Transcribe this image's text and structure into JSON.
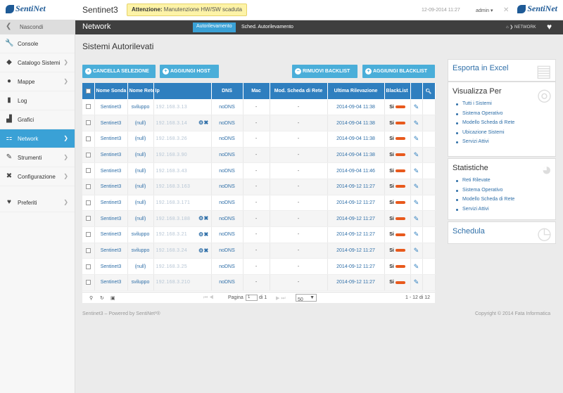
{
  "header": {
    "logo": "SentiNet",
    "app_title": "Sentinet3",
    "warning_label": "Attenzione:",
    "warning_text": "Manutenzione HW/SW scaduta",
    "datetime": "12-09-2014 11:27",
    "user": "admin"
  },
  "sidebar": {
    "hide_label": "Nascondi",
    "items": [
      {
        "label": "Console",
        "icon": "wrench-icon",
        "chevron": false
      },
      {
        "label": "Catalogo Sistemi",
        "icon": "tag-icon",
        "chevron": true
      },
      {
        "label": "Mappe",
        "icon": "globe-icon",
        "chevron": true
      },
      {
        "label": "Log",
        "icon": "book-icon",
        "chevron": false
      },
      {
        "label": "Grafici",
        "icon": "chart-icon",
        "chevron": false
      },
      {
        "label": "Network",
        "icon": "network-icon",
        "chevron": true,
        "active": true
      },
      {
        "label": "Strumenti",
        "icon": "tools-icon",
        "chevron": true
      },
      {
        "label": "Configurazione",
        "icon": "config-icon",
        "chevron": true
      },
      {
        "label": "Preferiti",
        "icon": "heart-icon",
        "chevron": true
      }
    ]
  },
  "navbar": {
    "section": "Network",
    "tab_active": "Autorilevamento",
    "tab_other": "Sched. Autorilevamento",
    "breadcrumb": "NETWORK"
  },
  "page": {
    "title": "Sistemi Autorilevati"
  },
  "buttons": {
    "cancel": "CANCELLA SELEZIONE",
    "add_host": "AGGIUNGI HOST",
    "remove_bl": "RIMUOVI BACKLIST",
    "add_bl": "AGGIUNGI BLACKLIST"
  },
  "table": {
    "headers": [
      "Nome Sonda",
      "Nome Rete",
      "Ip",
      "DNS",
      "Mac",
      "Mod. Scheda di Rete",
      "Ultima Rilevazione",
      "BlackList"
    ],
    "rows": [
      {
        "sonda": "Sentinet3",
        "rete": "sviluppo",
        "ip": "192.168.3.13",
        "tools": false,
        "dns": "noDNS",
        "mac": "-",
        "mod": "-",
        "date": "2014-09-04 11:38",
        "bl": "Si"
      },
      {
        "sonda": "Sentinet3",
        "rete": "(null)",
        "ip": "192.168.3.14",
        "tools": true,
        "dns": "noDNS",
        "mac": "-",
        "mod": "-",
        "date": "2014-09-04 11:38",
        "bl": "Si"
      },
      {
        "sonda": "Sentinet3",
        "rete": "(null)",
        "ip": "192.168.3.26",
        "tools": false,
        "dns": "noDNS",
        "mac": "-",
        "mod": "-",
        "date": "2014-09-04 11:38",
        "bl": "Si"
      },
      {
        "sonda": "Sentinet3",
        "rete": "(null)",
        "ip": "192.168.3.90",
        "tools": false,
        "dns": "noDNS",
        "mac": "-",
        "mod": "-",
        "date": "2014-09-04 11:38",
        "bl": "Si"
      },
      {
        "sonda": "Sentinet3",
        "rete": "(null)",
        "ip": "192.168.3.43",
        "tools": false,
        "dns": "noDNS",
        "mac": "-",
        "mod": "-",
        "date": "2014-09-04 11:46",
        "bl": "Si"
      },
      {
        "sonda": "Sentinet3",
        "rete": "(null)",
        "ip": "192.168.3.163",
        "tools": false,
        "dns": "noDNS",
        "mac": "-",
        "mod": "-",
        "date": "2014-09-12 11:27",
        "bl": "Si"
      },
      {
        "sonda": "Sentinet3",
        "rete": "(null)",
        "ip": "192.168.3.171",
        "tools": false,
        "dns": "noDNS",
        "mac": "-",
        "mod": "-",
        "date": "2014-09-12 11:27",
        "bl": "Si"
      },
      {
        "sonda": "Sentinet3",
        "rete": "(null)",
        "ip": "192.168.3.188",
        "tools": true,
        "dns": "noDNS",
        "mac": "-",
        "mod": "-",
        "date": "2014-09-12 11:27",
        "bl": "Si"
      },
      {
        "sonda": "Sentinet3",
        "rete": "sviluppo",
        "ip": "192.168.3.21",
        "tools": true,
        "dns": "noDNS",
        "mac": "-",
        "mod": "-",
        "date": "2014-09-12 11:27",
        "bl": "Si"
      },
      {
        "sonda": "Sentinet3",
        "rete": "sviluppo",
        "ip": "192.168.3.24",
        "tools": true,
        "dns": "noDNS",
        "mac": "-",
        "mod": "-",
        "date": "2014-09-12 11:27",
        "bl": "Si"
      },
      {
        "sonda": "Sentinet3",
        "rete": "(null)",
        "ip": "192.168.3.25",
        "tools": false,
        "dns": "noDNS",
        "mac": "-",
        "mod": "-",
        "date": "2014-09-12 11:27",
        "bl": "Si"
      },
      {
        "sonda": "Sentinet3",
        "rete": "sviluppo",
        "ip": "192.168.3.210",
        "tools": false,
        "dns": "noDNS",
        "mac": "-",
        "mod": "-",
        "date": "2014-09-12 11:27",
        "bl": "Si"
      }
    ]
  },
  "pager": {
    "page_label": "Pagina",
    "page_value": "1",
    "of_label": "di 1",
    "page_size": "50",
    "summary": "1 - 12 di 12"
  },
  "footer": {
    "left": "Sentinet3 – Powered by SentiNet³®",
    "right": "Copyright © 2014 Fata Informatica"
  },
  "panels": {
    "excel": "Esporta in Excel",
    "visualizza": {
      "title": "Visualizza Per",
      "items": [
        "Tutti i Sistemi",
        "Sistema Operativo",
        "Modello Scheda di Rete",
        "Ubicazione Sistemi",
        "Servizi Attivi"
      ]
    },
    "statistiche": {
      "title": "Statistiche",
      "items": [
        "Reti Rilevate",
        "Sistema Operativo",
        "Modello Scheda di Rete",
        "Servizi Attivi"
      ]
    },
    "schedula": "Schedula"
  },
  "colors": {
    "accent": "#3aa1d6",
    "header_blue": "#2f7fbf",
    "navbar": "#3f3f3f",
    "warning_bg": "#fdf3a7",
    "blacklist_plug": "#e8591c"
  }
}
